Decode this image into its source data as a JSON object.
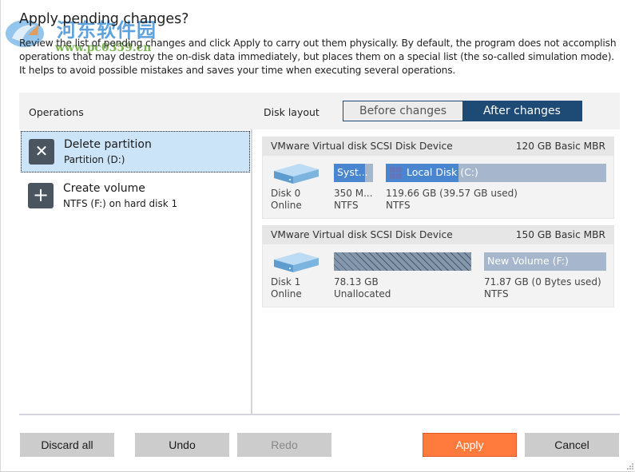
{
  "dialog": {
    "title": "Apply pending changes?",
    "description": "Review the list of pending changes and click Apply to carry out them physically. By default, the program does not accomplish operations that may destroy the on-disk data immediately, but places them on a special list (the so-called simulation mode). It helps to avoid possible mistakes and saves your time when executing several operations."
  },
  "watermark": {
    "text_cn": "河东软件园",
    "url": "www.pc0359.cn"
  },
  "operations": {
    "header": "Operations",
    "items": [
      {
        "icon": "close-icon",
        "glyph": "✕",
        "title": "Delete partition",
        "subtitle": "Partition (D:)",
        "selected": true
      },
      {
        "icon": "plus-icon",
        "glyph": "+",
        "title": "Create volume",
        "subtitle": "NTFS (F:) on hard disk 1",
        "selected": false
      }
    ]
  },
  "disk_layout": {
    "label": "Disk layout",
    "toggle": {
      "before": "Before changes",
      "after": "After changes",
      "active": "after"
    },
    "accent_color": "#1e4a76",
    "disks": [
      {
        "device": "VMware Virtual disk SCSI Disk Device",
        "size_type": "120 GB Basic MBR",
        "id": "Disk 0",
        "status": "Online",
        "partitions": [
          {
            "label": "Syst...",
            "size": "350 M...",
            "fs": "NTFS",
            "used_fraction": 0.8
          },
          {
            "label": "Local Disk (C:)",
            "size": "119.66 GB (39.57 GB used)",
            "fs": "NTFS",
            "used_fraction": 0.33
          }
        ]
      },
      {
        "device": "VMware Virtual disk SCSI Disk Device",
        "size_type": "150 GB Basic MBR",
        "id": "Disk 1",
        "status": "Online",
        "partitions": [
          {
            "label": "",
            "size": "78.13 GB",
            "fs": "Unallocated",
            "used_fraction": 0
          },
          {
            "label": "New Volume (F:)",
            "size": "71.87 GB (0 Bytes used)",
            "fs": "NTFS",
            "used_fraction": 0
          }
        ]
      }
    ]
  },
  "buttons": {
    "discard_all": "Discard all",
    "undo": "Undo",
    "redo": "Redo",
    "apply": "Apply",
    "cancel": "Cancel"
  },
  "colors": {
    "apply": "#ff7a3d",
    "partition_used": "#4a86d0",
    "partition_free": "#a5b6cd",
    "selection": "#cce4f7"
  }
}
